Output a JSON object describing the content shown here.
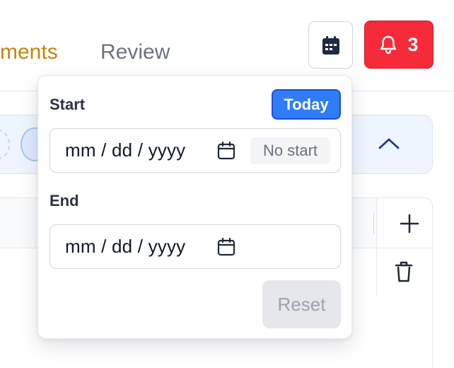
{
  "header": {
    "tabs": [
      {
        "label": "ments",
        "active": true
      },
      {
        "label": "Review",
        "active": false
      }
    ],
    "calendar_button": {
      "icon": "calendar-icon"
    },
    "notifications": {
      "icon": "bell-icon",
      "count": "3",
      "color": "#f52b3a"
    }
  },
  "date_popover": {
    "start": {
      "label": "Start",
      "value": "mm / dd / yyyy",
      "chip": "No start"
    },
    "end": {
      "label": "End",
      "value": "mm / dd / yyyy"
    },
    "today_button": "Today",
    "reset_button": "Reset",
    "accent": "#2f7cf6"
  },
  "background": {
    "filter_bar": {
      "collapse_icon": "chevron-up-icon"
    },
    "table_actions": {
      "add_icon": "plus-icon",
      "delete_icon": "trash-icon"
    }
  }
}
